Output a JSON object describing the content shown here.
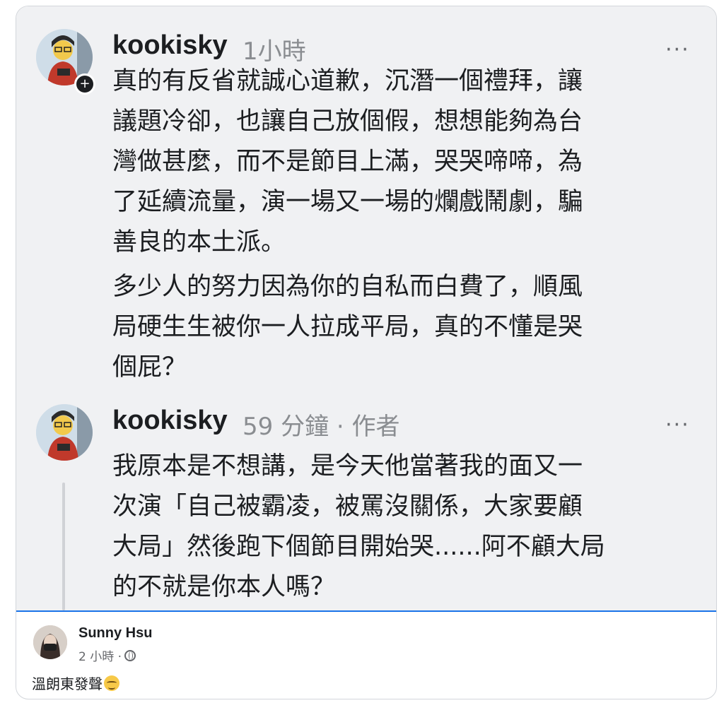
{
  "comments": [
    {
      "author": "kookisky",
      "time": "1小時",
      "more": "···",
      "badge": "+",
      "paragraphs": [
        [
          "真的有反省就誠心道歉，沉潛一個禮拜，讓",
          "議題冷卻，也讓自己放個假，想想能夠為台",
          "灣做甚麼，而不是節目上滿，哭哭啼啼，為",
          "了延續流量，演一場又一場的爛戲鬧劇，騙",
          "善良的本土派。"
        ],
        [
          "多少人的努力因為你的自私而白費了，順風",
          "局硬生生被你一人拉成平局，真的不懂是哭",
          "個屁？"
        ]
      ]
    },
    {
      "author": "kookisky",
      "time": "59 分鐘 · 作者",
      "more": "···",
      "paragraphs": [
        [
          "我原本是不想講，是今天他當著我的面又一",
          "次演「自己被霸凌，被罵沒關係，大家要顧",
          "大局」然後跑下個節目開始哭......阿不顧大局",
          "的不就是你本人嗎？"
        ]
      ]
    }
  ],
  "post": {
    "author": "Sunny Hsu",
    "time": "2 小時 ·",
    "privacy_icon": "globe-icon",
    "text": "溫朗東發聲",
    "emoji": "relieved-face-emoji"
  },
  "colors": {
    "comment_bg": "#f0f1f3",
    "divider": "#1a73e8",
    "meta": "#8a8d91"
  }
}
